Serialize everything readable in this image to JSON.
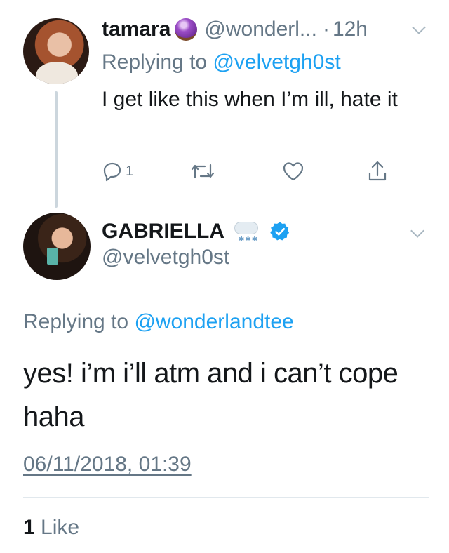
{
  "tweet1": {
    "name": "tamara",
    "name_emoji": "crystal-ball-emoji",
    "handle": "@wonderl...",
    "separator": "·",
    "time": "12h",
    "reply_prefix": "Replying to ",
    "reply_mention": "@velvetgh0st",
    "text": "I get like this when I’m ill, hate it",
    "reply_count": "1"
  },
  "tweet2": {
    "name": "GABRIELLA",
    "name_emoji": "cloud-with-snow-emoji",
    "verified": true,
    "handle": "@velvetgh0st",
    "reply_prefix": "Replying to ",
    "reply_mention": "@wonderlandtee",
    "text": "yes! i’m i’ll atm and i can’t cope haha",
    "timestamp": "06/11/2018, 01:39",
    "like_count": "1",
    "like_label": "Like"
  },
  "colors": {
    "accent": "#1da1f2",
    "secondary_text": "#657786",
    "primary_text": "#14171a",
    "thread_line": "#ccd6dd"
  }
}
